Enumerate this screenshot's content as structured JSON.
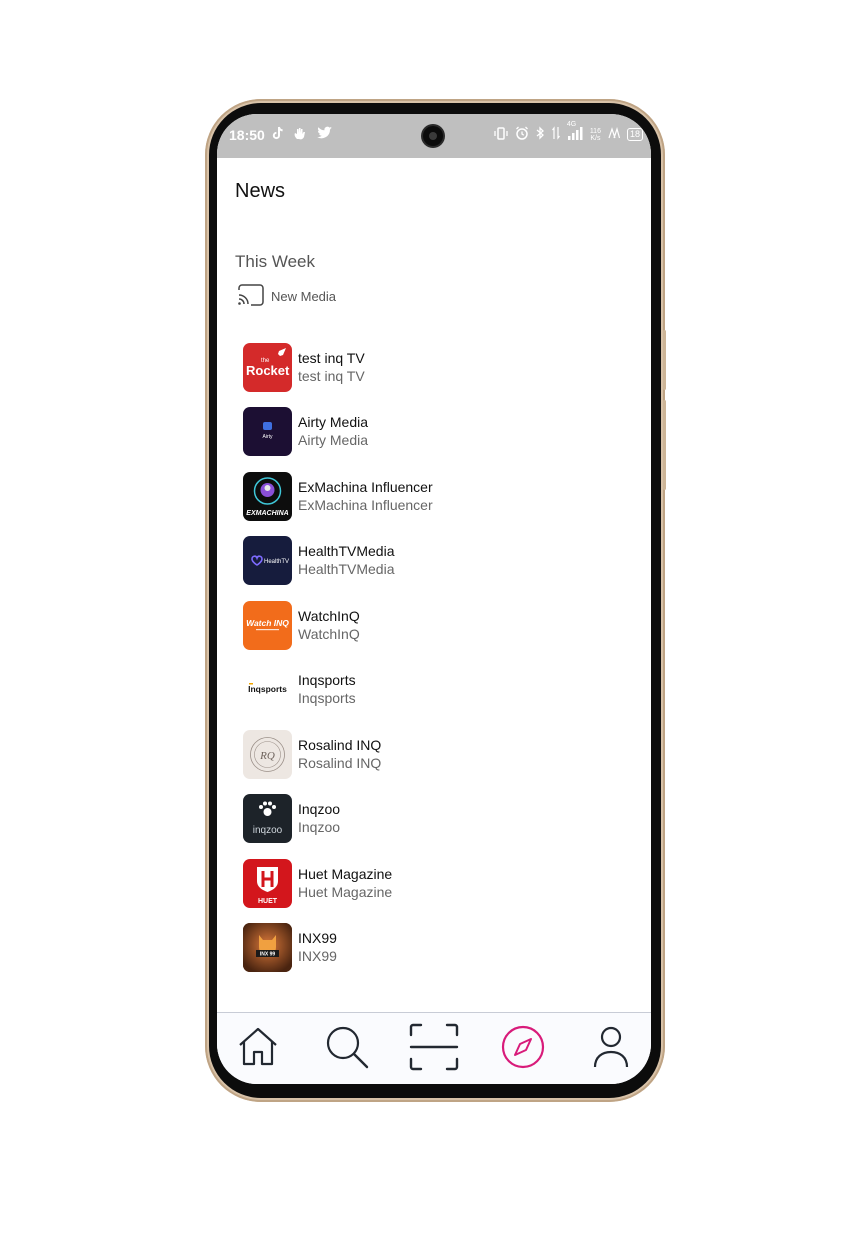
{
  "status_bar": {
    "time": "18:50",
    "left_icons": [
      "tiktok-icon",
      "hand-wave-icon",
      "twitter-icon"
    ],
    "net_speed_value": "116",
    "net_speed_unit": "K/s",
    "network": "4G",
    "battery": "18"
  },
  "page": {
    "title": "News",
    "section": "This Week",
    "media_tag": "New Media"
  },
  "channels": [
    {
      "name": "test inq TV",
      "subtitle": "test inq TV",
      "logo_text": "Rocket",
      "logo_small": "the",
      "logo_bg": "#d42a2a"
    },
    {
      "name": "Airty Media",
      "subtitle": "Airty Media",
      "logo_text": "Airty",
      "logo_bg": "#1c0f33"
    },
    {
      "name": "ExMachina Influencer",
      "subtitle": "ExMachina Influencer",
      "logo_text": "EXMACHINA",
      "logo_bg": "#0d0d0d"
    },
    {
      "name": "HealthTVMedia",
      "subtitle": "HealthTVMedia",
      "logo_text": "HealthTV",
      "logo_bg": "#161c3d"
    },
    {
      "name": "WatchInQ",
      "subtitle": "WatchInQ",
      "logo_text": "Watch INQ",
      "logo_bg": "#f26c1b"
    },
    {
      "name": "Inqsports",
      "subtitle": "Inqsports",
      "logo_text": "Inqsports",
      "logo_bg": "#ffffff"
    },
    {
      "name": "Rosalind INQ",
      "subtitle": "Rosalind INQ",
      "logo_text": "RQ",
      "logo_bg": "#ede7e2"
    },
    {
      "name": "Inqzoo",
      "subtitle": "Inqzoo",
      "logo_text": "inqzoo",
      "logo_bg": "#1d2329"
    },
    {
      "name": "Huet Magazine",
      "subtitle": "Huet Magazine",
      "logo_text": "HUET",
      "logo_bg": "#d3161c"
    },
    {
      "name": "INX99",
      "subtitle": "INX99",
      "logo_text": "INX 99",
      "logo_bg": "#7a3e1e"
    }
  ],
  "tabbar": {
    "items": [
      "home-icon",
      "search-icon",
      "scan-icon",
      "explore-icon",
      "profile-icon"
    ],
    "active": "explore-icon",
    "active_color": "#d81b7a",
    "inactive_color": "#222831"
  }
}
